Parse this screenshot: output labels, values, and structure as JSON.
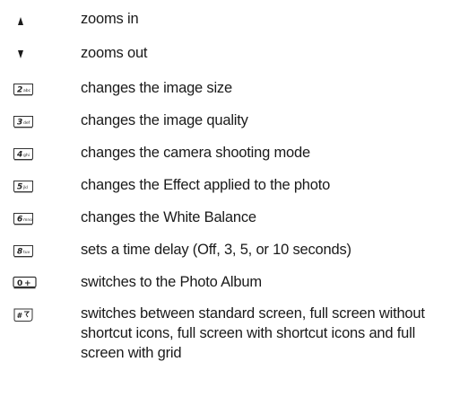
{
  "items": [
    {
      "icon": "up-arrow-icon",
      "text": "zooms in"
    },
    {
      "icon": "down-arrow-icon",
      "text": "zooms out"
    },
    {
      "icon": "key-2-icon",
      "text": "changes the image size"
    },
    {
      "icon": "key-3-icon",
      "text": "changes the image quality"
    },
    {
      "icon": "key-4-icon",
      "text": "changes the camera shooting mode"
    },
    {
      "icon": "key-5-icon",
      "text": "changes the Effect applied to the photo"
    },
    {
      "icon": "key-6-icon",
      "text": "changes the White Balance"
    },
    {
      "icon": "key-8-icon",
      "text": "sets a time delay (Off, 3, 5, or 10 seconds)"
    },
    {
      "icon": "key-0-icon",
      "text": "switches to the Photo Album"
    },
    {
      "icon": "key-hash-icon",
      "text": "switches between standard screen, full screen without shortcut icons,  full screen with shortcut icons and full screen with grid"
    }
  ],
  "keys": {
    "k2": {
      "digit": "2",
      "sub": "abc"
    },
    "k3": {
      "digit": "3",
      "sub": "def"
    },
    "k4": {
      "digit": "4",
      "sub": "ghi"
    },
    "k5": {
      "digit": "5",
      "sub": "jkl"
    },
    "k6": {
      "digit": "6",
      "sub": "mno"
    },
    "k8": {
      "digit": "8",
      "sub": "tuv"
    },
    "k0": {
      "digit": "0",
      "sub": "+"
    },
    "khash": {
      "digit": "#",
      "sub": "⌐"
    }
  }
}
